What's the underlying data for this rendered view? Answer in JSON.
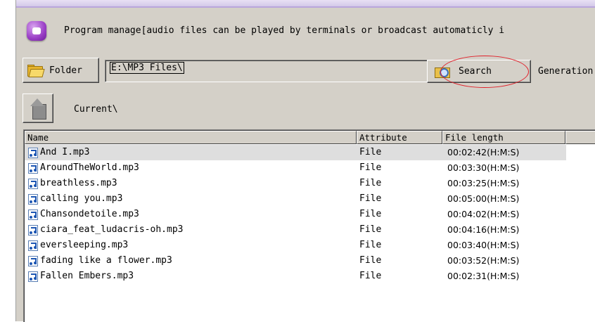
{
  "header": {
    "title": "Program manage[audio files can be played by terminals or broadcast automaticly i"
  },
  "toolbar": {
    "folder_label": "Folder",
    "path_value": "E:\\MP3 Files\\",
    "search_label": "Search",
    "generation_label": "Generation",
    "current_label": "Current\\"
  },
  "list": {
    "columns": [
      "Name",
      "Attribute",
      "File length"
    ],
    "rows": [
      {
        "name": "And I.mp3",
        "attribute": "File",
        "length": "00:02:42(H:M:S)"
      },
      {
        "name": "AroundTheWorld.mp3",
        "attribute": "File",
        "length": "00:03:30(H:M:S)"
      },
      {
        "name": "breathless.mp3",
        "attribute": "File",
        "length": "00:03:25(H:M:S)"
      },
      {
        "name": "calling you.mp3",
        "attribute": "File",
        "length": "00:05:00(H:M:S)"
      },
      {
        "name": "Chansondetoile.mp3",
        "attribute": "File",
        "length": "00:04:02(H:M:S)"
      },
      {
        "name": "ciara_feat_ludacris-oh.mp3",
        "attribute": "File",
        "length": "00:04:16(H:M:S)"
      },
      {
        "name": "eversleeping.mp3",
        "attribute": "File",
        "length": "00:03:40(H:M:S)"
      },
      {
        "name": "fading like a flower.mp3",
        "attribute": "File",
        "length": "00:03:52(H:M:S)"
      },
      {
        "name": "Fallen Embers.mp3",
        "attribute": "File",
        "length": "00:02:31(H:M:S)"
      }
    ]
  },
  "icons": {
    "app": "app-icon",
    "folder": "folder-icon",
    "search": "search-folder-icon",
    "up": "up-folder-icon",
    "file": "music-file-icon"
  },
  "colors": {
    "highlight_oval": "#e0202a",
    "window_bg": "#d4d0c8",
    "selected_row": "#dedede"
  }
}
